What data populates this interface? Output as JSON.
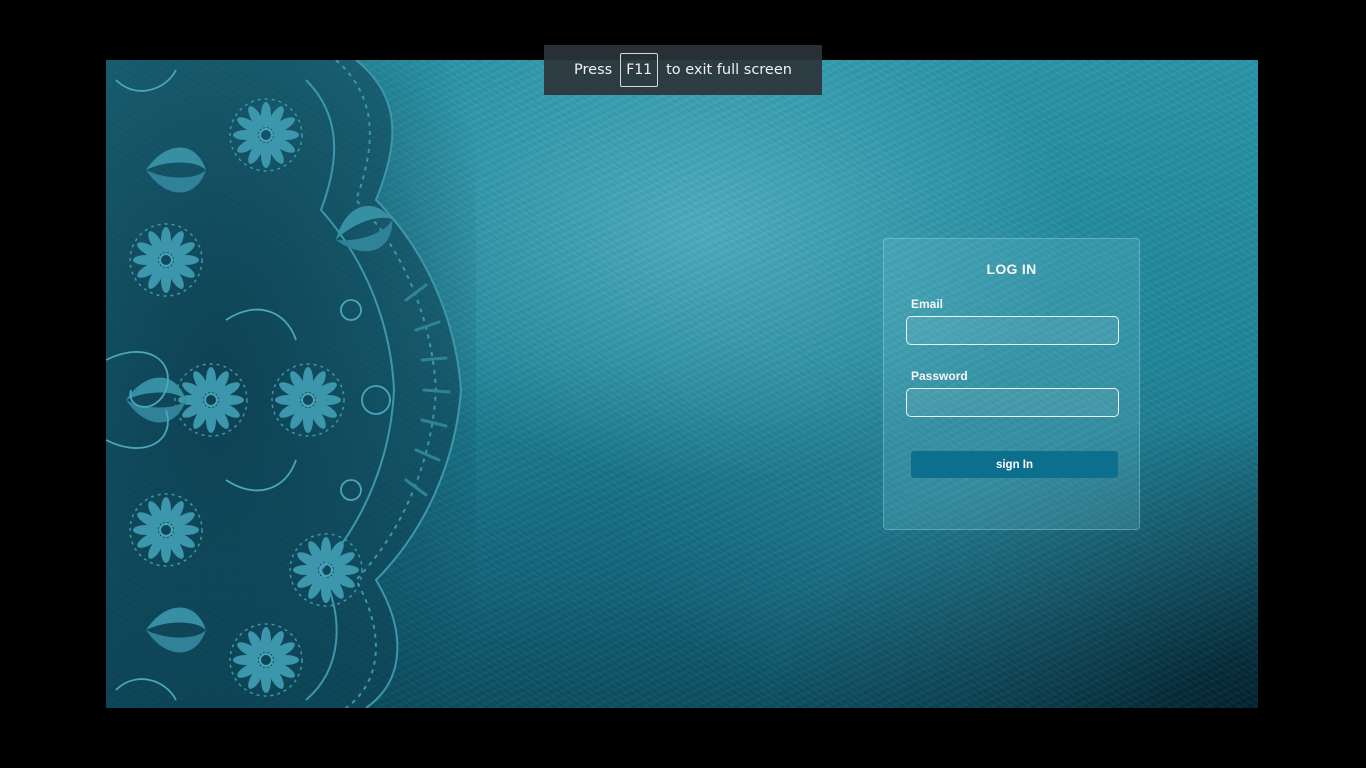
{
  "fullscreen_banner": {
    "press": "Press",
    "key": "F11",
    "rest": "to exit full screen"
  },
  "login": {
    "title": "LOG IN",
    "email_label": "Email",
    "email_value": "",
    "password_label": "Password",
    "password_value": "",
    "submit_label": "sign In"
  },
  "colors": {
    "background_teal": "#1f8599",
    "button": "#0d6f8e",
    "banner": "#2d343a"
  }
}
